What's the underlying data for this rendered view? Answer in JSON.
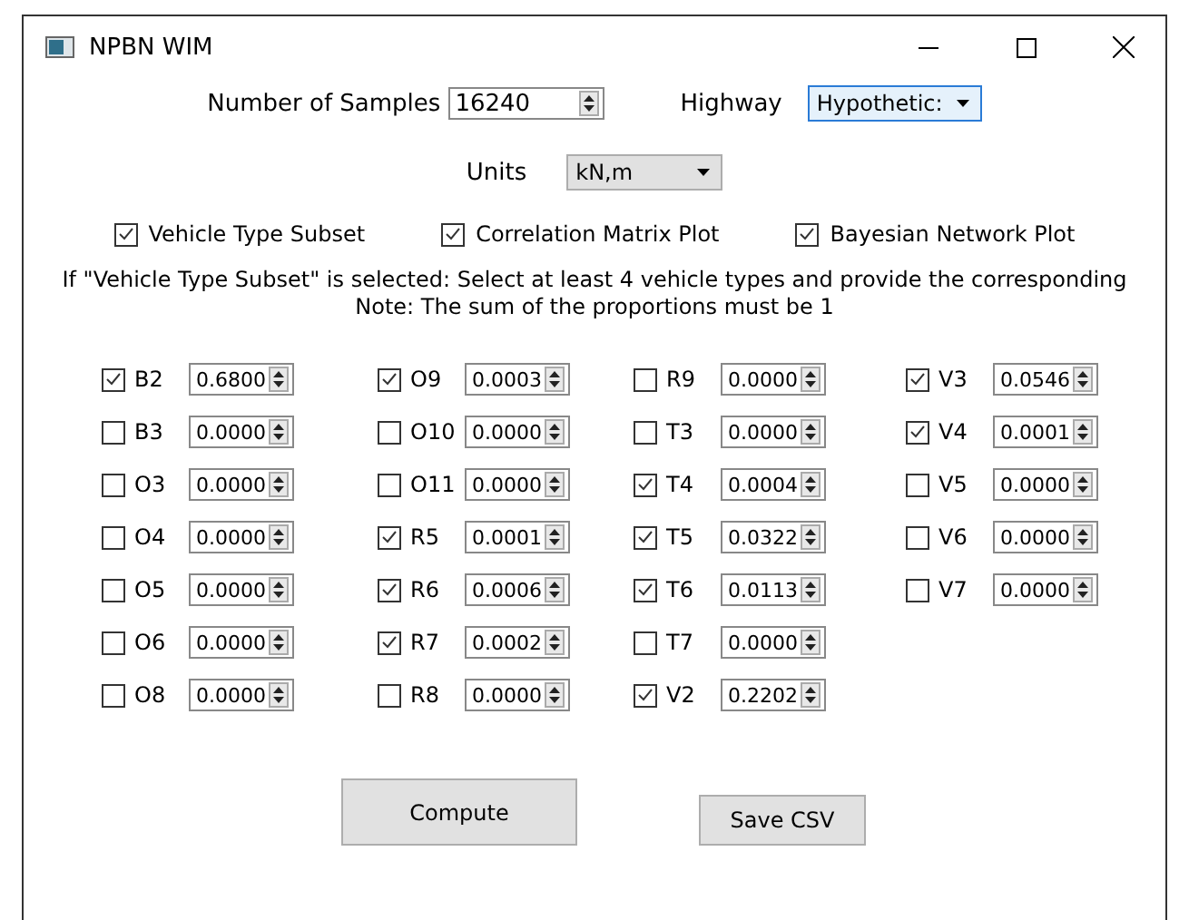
{
  "window": {
    "title": "NPBN WIM"
  },
  "samples": {
    "label": "Number of Samples",
    "value": "16240"
  },
  "highway": {
    "label": "Highway",
    "value": "Hypothetic:",
    "focused": true
  },
  "units": {
    "label": "Units",
    "value": "kN,m"
  },
  "options": [
    {
      "label": "Vehicle Type Subset",
      "checked": true
    },
    {
      "label": "Correlation Matrix Plot",
      "checked": true
    },
    {
      "label": "Bayesian Network Plot",
      "checked": true
    }
  ],
  "instructions": [
    "If \"Vehicle Type Subset\" is selected: Select at least 4 vehicle types and provide the corresponding",
    "Note: The sum of the proportions must be 1"
  ],
  "vehicle_columns": [
    [
      {
        "label": "B2",
        "checked": true,
        "value": "0.6800"
      },
      {
        "label": "B3",
        "checked": false,
        "value": "0.0000"
      },
      {
        "label": "O3",
        "checked": false,
        "value": "0.0000"
      },
      {
        "label": "O4",
        "checked": false,
        "value": "0.0000"
      },
      {
        "label": "O5",
        "checked": false,
        "value": "0.0000"
      },
      {
        "label": "O6",
        "checked": false,
        "value": "0.0000"
      },
      {
        "label": "O8",
        "checked": false,
        "value": "0.0000"
      }
    ],
    [
      {
        "label": "O9",
        "checked": true,
        "value": "0.0003"
      },
      {
        "label": "O10",
        "checked": false,
        "value": "0.0000"
      },
      {
        "label": "O11",
        "checked": false,
        "value": "0.0000"
      },
      {
        "label": "R5",
        "checked": true,
        "value": "0.0001"
      },
      {
        "label": "R6",
        "checked": true,
        "value": "0.0006"
      },
      {
        "label": "R7",
        "checked": true,
        "value": "0.0002"
      },
      {
        "label": "R8",
        "checked": false,
        "value": "0.0000"
      }
    ],
    [
      {
        "label": "R9",
        "checked": false,
        "value": "0.0000"
      },
      {
        "label": "T3",
        "checked": false,
        "value": "0.0000"
      },
      {
        "label": "T4",
        "checked": true,
        "value": "0.0004"
      },
      {
        "label": "T5",
        "checked": true,
        "value": "0.0322"
      },
      {
        "label": "T6",
        "checked": true,
        "value": "0.0113"
      },
      {
        "label": "T7",
        "checked": false,
        "value": "0.0000"
      },
      {
        "label": "V2",
        "checked": true,
        "value": "0.2202"
      }
    ],
    [
      {
        "label": "V3",
        "checked": true,
        "value": "0.0546"
      },
      {
        "label": "V4",
        "checked": true,
        "value": "0.0001"
      },
      {
        "label": "V5",
        "checked": false,
        "value": "0.0000"
      },
      {
        "label": "V6",
        "checked": false,
        "value": "0.0000"
      },
      {
        "label": "V7",
        "checked": false,
        "value": "0.0000"
      }
    ]
  ],
  "buttons": [
    {
      "label": "Compute",
      "kind": "large"
    },
    {
      "label": "Save CSV",
      "kind": "small"
    }
  ]
}
